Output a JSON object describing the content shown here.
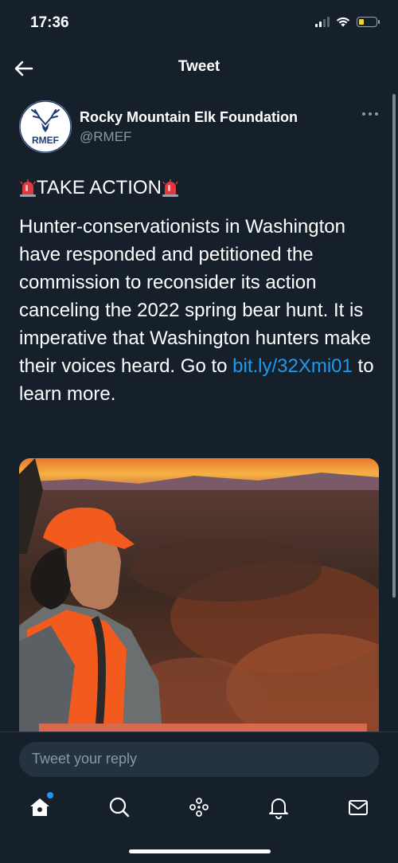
{
  "status_bar": {
    "time": "17:36",
    "icons": [
      "signal-icon",
      "wifi-icon",
      "battery-icon"
    ],
    "battery_color": "#f2d22e"
  },
  "nav": {
    "title": "Tweet",
    "back_icon": "back-arrow-icon"
  },
  "author": {
    "name": "Rocky Mountain Elk Foundation",
    "handle": "@RMEF",
    "avatar_text": "RMEF",
    "more_icon": "more-icon"
  },
  "tweet": {
    "headline": "TAKE ACTION",
    "headline_icon": "siren-icon",
    "body_before_link": "Hunter-conservationists in Washington have responded and petitioned the commission to reconsider its action canceling the 2022 spring bear hunt. It is imperative that Washington hunters make their voices heard.  Go to ",
    "link_text": "bit.ly/32Xmi01",
    "body_after_link": " to learn more.",
    "link_color": "#1d9bf0",
    "media_icon": "photo-hunter-sunset"
  },
  "reply": {
    "placeholder": "Tweet your reply"
  },
  "tabs": [
    {
      "name": "home",
      "icon": "home-icon",
      "active": true,
      "has_notification": true
    },
    {
      "name": "search",
      "icon": "search-icon"
    },
    {
      "name": "spaces",
      "icon": "spaces-icon"
    },
    {
      "name": "notifications",
      "icon": "bell-icon"
    },
    {
      "name": "messages",
      "icon": "mail-icon"
    }
  ],
  "colors": {
    "background": "#15202b",
    "secondary_text": "#8b98a5",
    "accent": "#1d9bf0"
  }
}
